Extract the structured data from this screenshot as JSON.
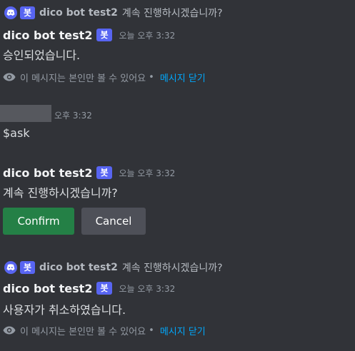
{
  "colors": {
    "background": "#313338",
    "bot_tag": "#5865f2",
    "confirm_button": "#248046",
    "cancel_button": "#4e5058",
    "link": "#00a8fc"
  },
  "messages": [
    {
      "reference": {
        "icon": "discord-logo-icon",
        "bot_tag": "봇",
        "author": "dico bot test2",
        "content": "계속 진행하시겠습니까?"
      },
      "author": "dico bot test2",
      "bot_tag": "봇",
      "timestamp": "오늘 오후 3:32",
      "content": "승인되었습니다.",
      "ephemeral": {
        "icon": "eye-icon",
        "notice": "이 메시지는 본인만 볼 수 있어요",
        "separator": "•",
        "dismiss": "메시지 닫기"
      }
    },
    {
      "timestamp": "오후 3:32",
      "content": "$ask"
    },
    {
      "author": "dico bot test2",
      "bot_tag": "봇",
      "timestamp": "오늘 오후 3:32",
      "content": "계속 진행하시겠습니까?",
      "buttons": {
        "confirm": "Confirm",
        "cancel": "Cancel"
      }
    },
    {
      "reference": {
        "icon": "discord-logo-icon",
        "bot_tag": "봇",
        "author": "dico bot test2",
        "content": "계속 진행하시겠습니까?"
      },
      "author": "dico bot test2",
      "bot_tag": "봇",
      "timestamp": "오늘 오후 3:32",
      "content": "사용자가 취소하였습니다.",
      "ephemeral": {
        "icon": "eye-icon",
        "notice": "이 메시지는 본인만 볼 수 있어요",
        "separator": "•",
        "dismiss": "메시지 닫기"
      }
    }
  ]
}
